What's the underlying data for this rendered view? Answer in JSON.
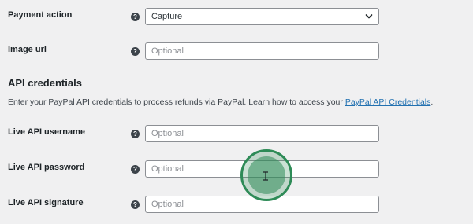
{
  "settings": {
    "payment_action": {
      "label": "Payment action",
      "value": "Capture"
    },
    "image_url": {
      "label": "Image url",
      "placeholder": "Optional"
    }
  },
  "api_credentials": {
    "title": "API credentials",
    "description_prefix": "Enter your PayPal API credentials to process refunds via PayPal. Learn how to access your ",
    "description_link": "PayPal API Credentials",
    "description_suffix": ".",
    "username": {
      "label": "Live API username",
      "placeholder": "Optional"
    },
    "password": {
      "label": "Live API password",
      "placeholder": "Optional"
    },
    "signature": {
      "label": "Live API signature",
      "placeholder": "Optional"
    }
  },
  "help_icon_glyph": "?",
  "colors": {
    "background": "#f0f0f1",
    "link": "#2271b1",
    "cursor_highlight": "#2e8b57"
  }
}
